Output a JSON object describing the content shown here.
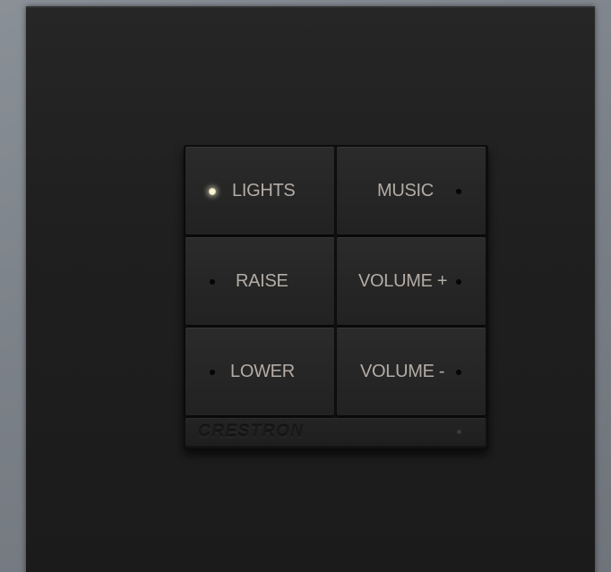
{
  "keypad": {
    "brand": "CRESTRON",
    "buttons": [
      {
        "label": "LIGHTS",
        "led": "on"
      },
      {
        "label": "MUSIC",
        "led": "off"
      },
      {
        "label": "RAISE",
        "led": "off"
      },
      {
        "label": "VOLUME +",
        "led": "off"
      },
      {
        "label": "LOWER",
        "led": "off"
      },
      {
        "label": "VOLUME -",
        "led": "off"
      }
    ]
  },
  "colors": {
    "wall": "#7b8188",
    "plate": "#1f1f1f",
    "label": "#b3aca6",
    "led_on": "#f1eccc"
  }
}
